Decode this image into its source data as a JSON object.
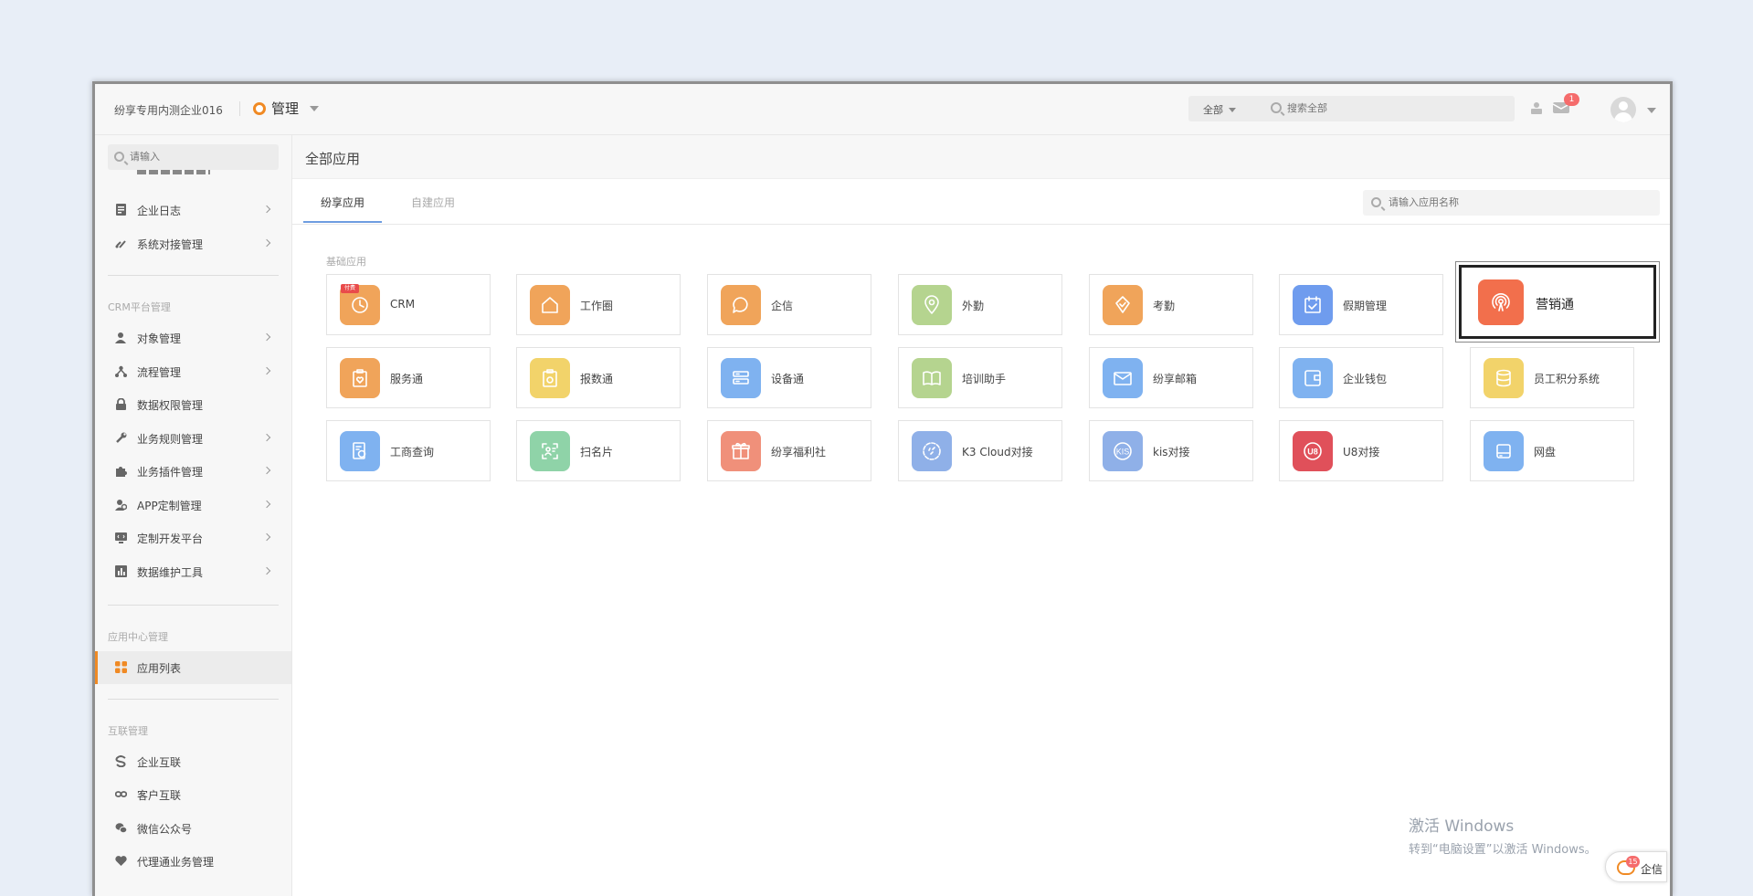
{
  "header": {
    "company": "纷享专用内测企业016",
    "module": "管理",
    "search_scope": "全部",
    "search_placeholder": "搜索全部",
    "message_badge": "1"
  },
  "sidebar": {
    "search_placeholder": "请输入",
    "items_top": [
      {
        "label": "企业日志",
        "icon": "log-icon",
        "has_arrow": true
      },
      {
        "label": "系统对接管理",
        "icon": "link-icon",
        "has_arrow": true
      }
    ],
    "sections": [
      {
        "title": "CRM平台管理",
        "items": [
          {
            "label": "对象管理",
            "icon": "user-icon"
          },
          {
            "label": "流程管理",
            "icon": "flow-icon"
          },
          {
            "label": "数据权限管理",
            "icon": "lock-icon"
          },
          {
            "label": "业务规则管理",
            "icon": "wrench-icon"
          },
          {
            "label": "业务插件管理",
            "icon": "puzzle-icon"
          },
          {
            "label": "APP定制管理",
            "icon": "app-icon"
          },
          {
            "label": "定制开发平台",
            "icon": "monitor-icon"
          },
          {
            "label": "数据维护工具",
            "icon": "chart-icon"
          }
        ]
      },
      {
        "title": "应用中心管理",
        "items": [
          {
            "label": "应用列表",
            "icon": "grid-icon",
            "active": true
          }
        ]
      },
      {
        "title": "互联管理",
        "items": [
          {
            "label": "企业互联",
            "icon": "s-link-icon"
          },
          {
            "label": "客户互联",
            "icon": "infinity-icon"
          },
          {
            "label": "微信公众号",
            "icon": "wechat-icon"
          },
          {
            "label": "代理通业务管理",
            "icon": "heart-icon"
          }
        ]
      }
    ]
  },
  "main": {
    "title": "全部应用",
    "tabs": [
      "纷享应用",
      "自建应用"
    ],
    "app_search_placeholder": "请输入应用名称",
    "group_label": "基础应用",
    "apps": [
      {
        "name": "CRM",
        "color": "#f0a45a",
        "icon": "clock-icon",
        "ribbon": "付费"
      },
      {
        "name": "工作圈",
        "color": "#f0a45a",
        "icon": "home-icon"
      },
      {
        "name": "企信",
        "color": "#f0a45a",
        "icon": "chat-icon"
      },
      {
        "name": "外勤",
        "color": "#b5d48f",
        "icon": "location-icon"
      },
      {
        "name": "考勤",
        "color": "#f0a45a",
        "icon": "shield-check-icon"
      },
      {
        "name": "假期管理",
        "color": "#6f9cee",
        "icon": "calendar-icon"
      },
      {
        "name": "营销通",
        "color": "#f26f4c",
        "icon": "broadcast-icon",
        "highlight": true
      },
      {
        "name": "服务通",
        "color": "#f0a45a",
        "icon": "clipboard-heart-icon"
      },
      {
        "name": "报数通",
        "color": "#f2d36a",
        "icon": "clipboard-icon"
      },
      {
        "name": "设备通",
        "color": "#7fb2f0",
        "icon": "server-icon"
      },
      {
        "name": "培训助手",
        "color": "#b5d48f",
        "icon": "book-icon"
      },
      {
        "name": "纷享邮箱",
        "color": "#7fb2f0",
        "icon": "mail-icon"
      },
      {
        "name": "企业钱包",
        "color": "#7fb2f0",
        "icon": "wallet-icon"
      },
      {
        "name": "员工积分系统",
        "color": "#f2d36a",
        "icon": "coins-icon"
      },
      {
        "name": "工商查询",
        "color": "#7fb2f0",
        "icon": "search-doc-icon"
      },
      {
        "name": "扫名片",
        "color": "#8fd3a8",
        "icon": "scan-card-icon"
      },
      {
        "name": "纷享福利社",
        "color": "#f0907a",
        "icon": "gift-icon"
      },
      {
        "name": "K3 Cloud对接",
        "color": "#8fb0e8",
        "icon": "cloud-sync-icon"
      },
      {
        "name": "kis对接",
        "color": "#8fb0e8",
        "icon": "kis-icon"
      },
      {
        "name": "U8对接",
        "color": "#e0505a",
        "icon": "u8-icon"
      },
      {
        "name": "网盘",
        "color": "#7fb2f0",
        "icon": "drive-icon"
      }
    ]
  },
  "watermark": {
    "line1": "激活 Windows",
    "line2": "转到“电脑设置”以激活 Windows。"
  },
  "qixin_float": {
    "label": "企信",
    "badge": "15"
  }
}
